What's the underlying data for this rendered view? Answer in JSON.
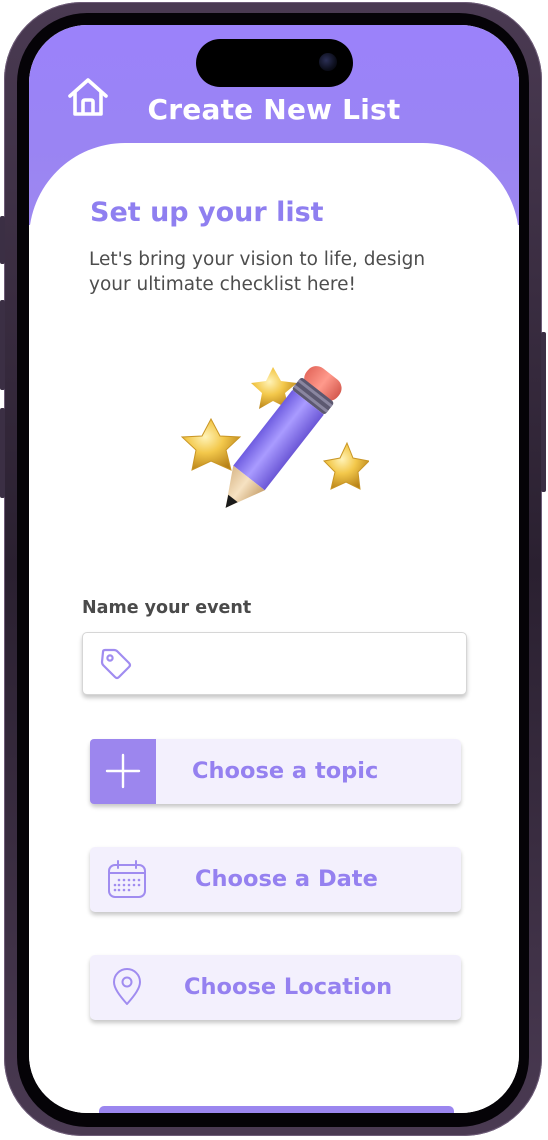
{
  "header": {
    "title": "Create New List",
    "accent": "#9b84f4",
    "home_icon": "home-icon"
  },
  "intro": {
    "heading": "Set up your list",
    "subtitle": "Let's bring your vision to life, design your ultimate checklist here!",
    "illustration": "pencil-with-stars-illustration"
  },
  "form": {
    "name_label": "Name your event",
    "name_value": "",
    "name_placeholder": "",
    "name_icon": "tag-icon",
    "topic_label": "Choose a topic",
    "topic_icon": "plus-icon",
    "date_label": "Choose a Date",
    "date_icon": "calendar-icon",
    "location_label": "Choose Location",
    "location_icon": "location-pin-icon"
  },
  "colors": {
    "primary": "#9b84f4",
    "button_bg": "#f3f0fd",
    "text_dark": "#4a4a4a"
  }
}
